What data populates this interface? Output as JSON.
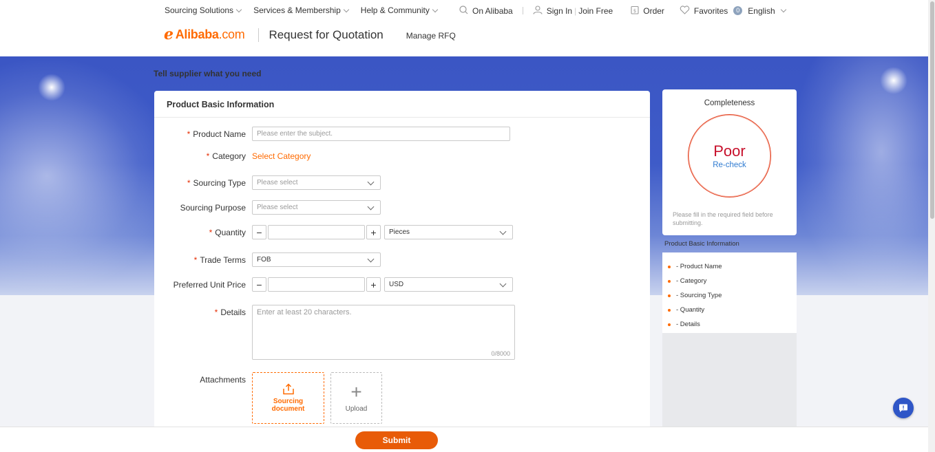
{
  "topnav": {
    "items": [
      "Sourcing Solutions",
      "Services & Membership",
      "Help & Community"
    ]
  },
  "topright": {
    "on_alibaba": "On Alibaba",
    "sign_in": "Sign In",
    "join_free": "Join Free",
    "order": "Order",
    "favorites": "Favorites",
    "favorites_count": "0",
    "language": "English"
  },
  "brand": {
    "logo_text": "Alibaba",
    "logo_com": ".com",
    "page_title": "Request for Quotation",
    "manage_rfq": "Manage RFQ"
  },
  "banner": {
    "title": "Tell supplier what you need"
  },
  "form": {
    "section_title": "Product Basic Information",
    "product_name": {
      "label": "Product Name",
      "placeholder": "Please enter the subject."
    },
    "category": {
      "label": "Category",
      "action": "Select Category"
    },
    "sourcing_type": {
      "label": "Sourcing Type",
      "placeholder": "Please select"
    },
    "sourcing_purpose": {
      "label": "Sourcing Purpose",
      "placeholder": "Please select"
    },
    "quantity": {
      "label": "Quantity",
      "minus": "−",
      "plus": "+",
      "unit": "Pieces"
    },
    "trade_terms": {
      "label": "Trade Terms",
      "value": "FOB"
    },
    "unit_price": {
      "label": "Preferred Unit Price",
      "minus": "−",
      "plus": "+",
      "currency": "USD"
    },
    "details": {
      "label": "Details",
      "placeholder": "Enter at least 20 characters.",
      "counter": "0/8000"
    },
    "attachments": {
      "label": "Attachments",
      "sourcing_doc": "Sourcing document",
      "upload": "Upload"
    }
  },
  "completeness": {
    "title": "Completeness",
    "rating": "Poor",
    "recheck": "Re-check",
    "note": "Please fill in the required field before submitting.",
    "section": "Product Basic Information",
    "items": [
      "- Product Name",
      "- Category",
      "- Sourcing Type",
      "- Quantity",
      "- Details"
    ]
  },
  "footer": {
    "submit": "Submit"
  },
  "colors": {
    "accent": "#ff6a00",
    "required": "#e62e04",
    "submit": "#e85b08",
    "poor": "#c7102b",
    "link": "#2f7bd1",
    "banner": "#3e5bc8"
  },
  "icons": {
    "search": "search-icon",
    "user": "user-icon",
    "order": "order-icon",
    "favorites": "heart-icon",
    "chat": "chat-icon"
  }
}
